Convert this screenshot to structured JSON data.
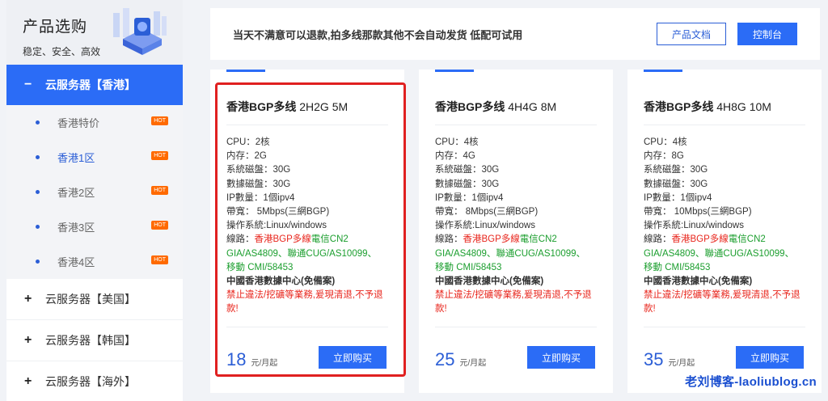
{
  "sidebar": {
    "title": "产品选购",
    "subtitle": "稳定、安全、高效",
    "active_group": {
      "sign": "−",
      "label": "云服务器【香港】"
    },
    "sub_items": [
      {
        "label": "香港特价",
        "badge": "HOT",
        "active": false
      },
      {
        "label": "香港1区",
        "badge": "HOT",
        "active": true
      },
      {
        "label": "香港2区",
        "badge": "HOT",
        "active": false
      },
      {
        "label": "香港3区",
        "badge": "HOT",
        "active": false
      },
      {
        "label": "香港4区",
        "badge": "HOT",
        "active": false
      }
    ],
    "groups": [
      {
        "sign": "+",
        "label": "云服务器【美国】"
      },
      {
        "sign": "+",
        "label": "云服务器【韩国】"
      },
      {
        "sign": "+",
        "label": "云服务器【海外】"
      }
    ]
  },
  "notice": {
    "text": "当天不满意可以退款,拍多线那款其他不会自动发货 低配可试用",
    "doc_button": "产品文档",
    "console_button": "控制台"
  },
  "cards": [
    {
      "title_plan": "香港BGP多线",
      "title_spec": "2H2G 5M",
      "cpu": "CPU：2核",
      "mem": "内存：2G",
      "sysdisk": "系統磁盤：30G",
      "datadisk": "數據磁盤：30G",
      "ip": "IP數量：1個ipv4",
      "bandwidth": "帶寬： 5Mbps(三網BGP)",
      "os": "操作系統:Linux/windows",
      "line_label": "線路：",
      "line_red": "香港BGP多線",
      "line_green1": "電信CN2 GIA/AS4809、",
      "line_green2": "聯通CUG/AS10099、",
      "line_green3": "移動 CMI/58453",
      "datacenter": "中國香港數據中心(免備案)",
      "warning": "禁止違法/挖礦等業務,爰現清退,不予退款!",
      "price": "18",
      "price_unit": "元/月起",
      "buy_label": "立即购买"
    },
    {
      "title_plan": "香港BGP多线",
      "title_spec": "4H4G 8M",
      "cpu": "CPU：4核",
      "mem": "内存：4G",
      "sysdisk": "系統磁盤：30G",
      "datadisk": "數據磁盤：30G",
      "ip": "IP數量：1個ipv4",
      "bandwidth": "帶寬： 8Mbps(三網BGP)",
      "os": "操作系統:Linux/windows",
      "line_label": "線路：",
      "line_red": "香港BGP多線",
      "line_green1": "電信CN2 GIA/AS4809、",
      "line_green2": "聯通CUG/AS10099、",
      "line_green3": "移動 CMI/58453",
      "datacenter": "中國香港數據中心(免備案)",
      "warning": "禁止違法/挖礦等業務,爰現清退,不予退款!",
      "price": "25",
      "price_unit": "元/月起",
      "buy_label": "立即购买"
    },
    {
      "title_plan": "香港BGP多线",
      "title_spec": "4H8G 10M",
      "cpu": "CPU：4核",
      "mem": "内存：8G",
      "sysdisk": "系統磁盤：30G",
      "datadisk": "數據磁盤：30G",
      "ip": "IP數量：1個ipv4",
      "bandwidth": "帶寬： 10Mbps(三網BGP)",
      "os": "操作系統:Linux/windows",
      "line_label": "線路：",
      "line_red": "香港BGP多線",
      "line_green1": "電信CN2 GIA/AS4809、",
      "line_green2": "聯通CUG/AS10099、",
      "line_green3": "移動 CMI/58453",
      "datacenter": "中國香港數據中心(免備案)",
      "warning": "禁止違法/挖礦等業務,爰現清退,不予退款!",
      "price": "35",
      "price_unit": "元/月起",
      "buy_label": "立即购买"
    }
  ],
  "watermark": "老刘博客-laoliublog.cn",
  "colors": {
    "accent": "#2b6cf6",
    "red": "#e8251c",
    "green": "#1b9e2e",
    "hot": "#ff6a00"
  }
}
